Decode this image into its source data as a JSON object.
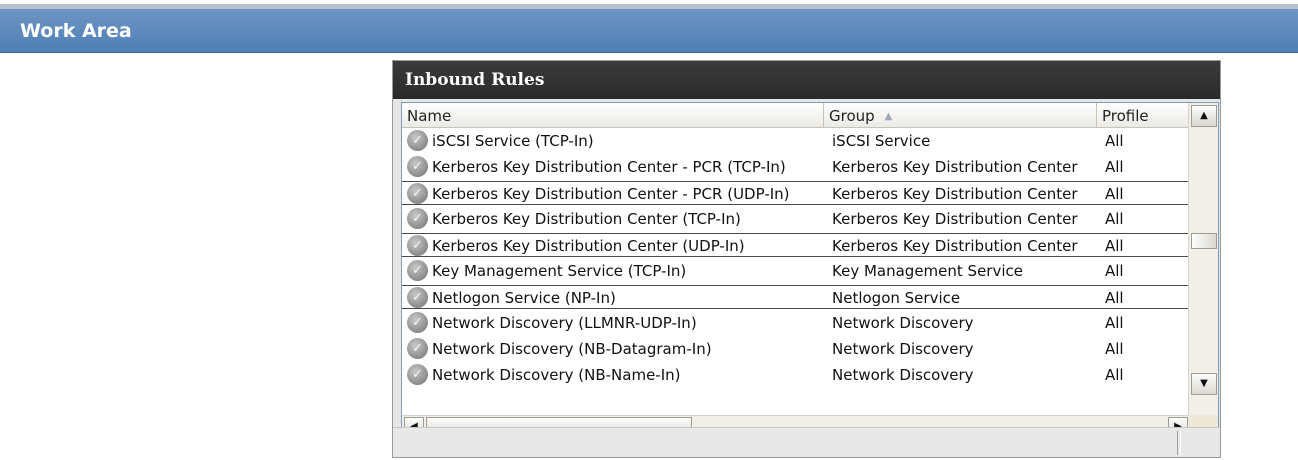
{
  "work_area": {
    "title": "Work Area"
  },
  "panel": {
    "title": "Inbound Rules",
    "columns": {
      "name": "Name",
      "group": "Group",
      "profile": "Profile"
    },
    "sort": {
      "column": "Group",
      "direction": "ascending",
      "arrow": "▲"
    },
    "rows": [
      {
        "name": "iSCSI Service (TCP-In)",
        "group": "iSCSI Service",
        "profile": "All"
      },
      {
        "name": "Kerberos Key Distribution Center - PCR (TCP-In)",
        "group": "Kerberos Key Distribution Center",
        "profile": "All"
      },
      {
        "name": "Kerberos Key Distribution Center - PCR (UDP-In)",
        "group": "Kerberos Key Distribution Center",
        "profile": "All"
      },
      {
        "name": "Kerberos Key Distribution Center (TCP-In)",
        "group": "Kerberos Key Distribution Center",
        "profile": "All"
      },
      {
        "name": "Kerberos Key Distribution Center (UDP-In)",
        "group": "Kerberos Key Distribution Center",
        "profile": "All"
      },
      {
        "name": "Key Management Service (TCP-In)",
        "group": "Key Management Service",
        "profile": "All"
      },
      {
        "name": "Netlogon Service (NP-In)",
        "group": "Netlogon Service",
        "profile": "All"
      },
      {
        "name": "Network Discovery (LLMNR-UDP-In)",
        "group": "Network Discovery",
        "profile": "All"
      },
      {
        "name": "Network Discovery (NB-Datagram-In)",
        "group": "Network Discovery",
        "profile": "All"
      },
      {
        "name": "Network Discovery (NB-Name-In)",
        "group": "Network Discovery",
        "profile": "All"
      }
    ],
    "row_icon": "rule-enabled-check-icon",
    "scroll": {
      "up_arrow": "▲",
      "down_arrow": "▼",
      "left_arrow": "◀",
      "right_arrow": "▶"
    }
  },
  "colors": {
    "work_area_bar": "#5a86bc",
    "panel_header": "#333333",
    "rule_icon": "#8a8a8a"
  }
}
